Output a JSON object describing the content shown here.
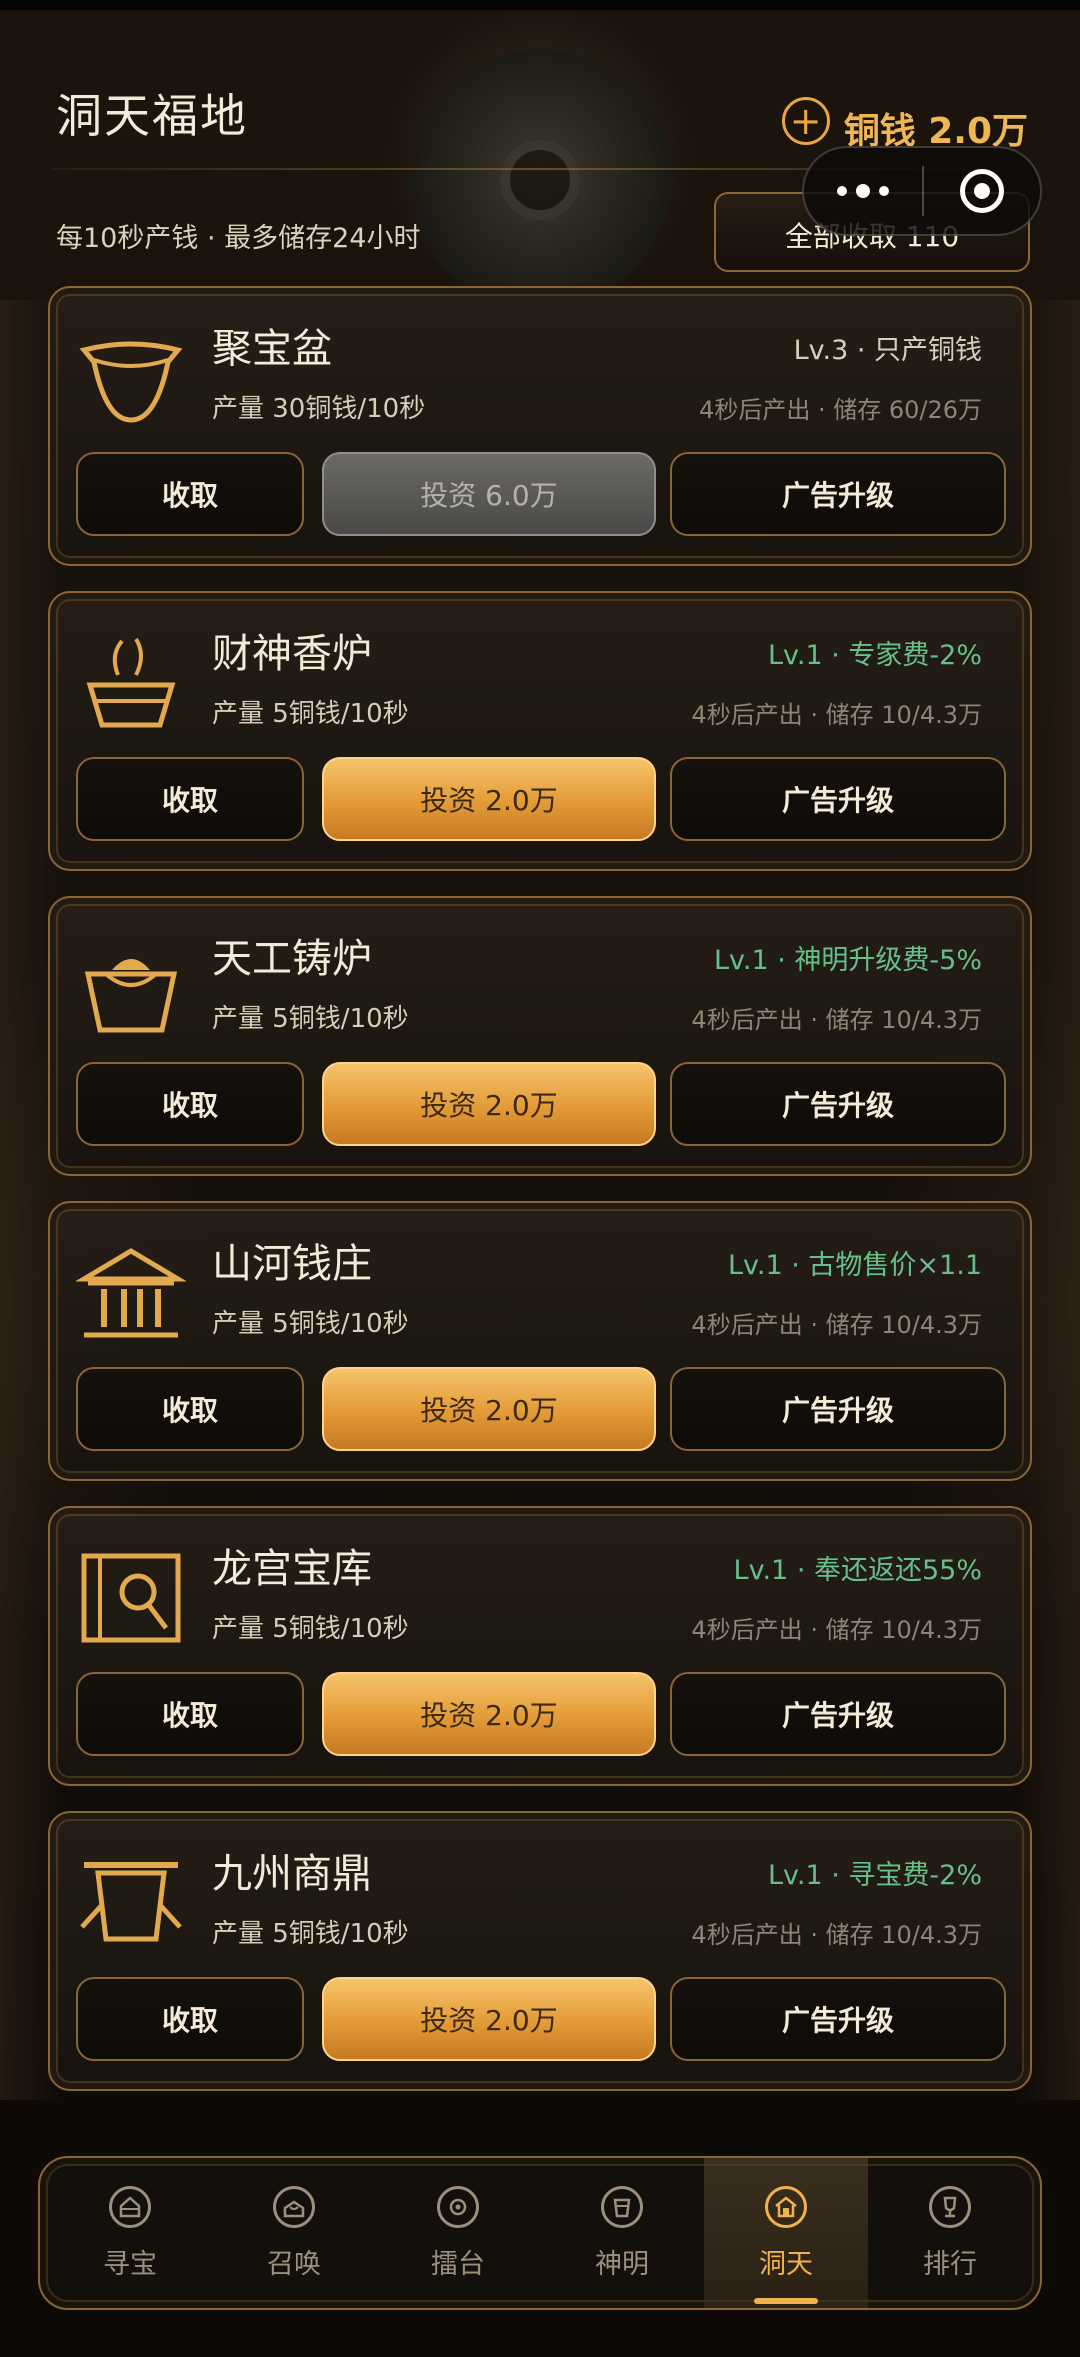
{
  "header": {
    "title": "洞天福地",
    "coins": "铜钱 2.0万",
    "subtitle": "每10秒产钱 · 最多储存24小时",
    "collect_all": "全部收取 110"
  },
  "buildings": [
    {
      "name": "聚宝盆",
      "icon": "treasure-bowl-icon",
      "rate": "产量 30铜钱/10秒",
      "level": "Lv.3 · 只产铜钱",
      "level_highlight": false,
      "timer": "4秒后产出 · 储存 60/26万",
      "collect": "收取",
      "invest": "投资 6.0万",
      "invest_disabled": true,
      "ad": "广告升级"
    },
    {
      "name": "财神香炉",
      "icon": "incense-burner-icon",
      "rate": "产量 5铜钱/10秒",
      "level": "Lv.1 · 专家费-2%",
      "level_highlight": true,
      "timer": "4秒后产出 · 储存 10/4.3万",
      "collect": "收取",
      "invest": "投资 2.0万",
      "invest_disabled": false,
      "ad": "广告升级"
    },
    {
      "name": "天工铸炉",
      "icon": "forge-icon",
      "rate": "产量 5铜钱/10秒",
      "level": "Lv.1 · 神明升级费-5%",
      "level_highlight": true,
      "timer": "4秒后产出 · 储存 10/4.3万",
      "collect": "收取",
      "invest": "投资 2.0万",
      "invest_disabled": false,
      "ad": "广告升级"
    },
    {
      "name": "山河钱庄",
      "icon": "bank-icon",
      "rate": "产量 5铜钱/10秒",
      "level": "Lv.1 · 古物售价×1.1",
      "level_highlight": true,
      "timer": "4秒后产出 · 储存 10/4.3万",
      "collect": "收取",
      "invest": "投资 2.0万",
      "invest_disabled": false,
      "ad": "广告升级"
    },
    {
      "name": "龙宫宝库",
      "icon": "vault-icon",
      "rate": "产量 5铜钱/10秒",
      "level": "Lv.1 · 奉还返还55%",
      "level_highlight": true,
      "timer": "4秒后产出 · 储存 10/4.3万",
      "collect": "收取",
      "invest": "投资 2.0万",
      "invest_disabled": false,
      "ad": "广告升级"
    },
    {
      "name": "九州商鼎",
      "icon": "cauldron-icon",
      "rate": "产量 5铜钱/10秒",
      "level": "Lv.1 · 寻宝费-2%",
      "level_highlight": true,
      "timer": "4秒后产出 · 储存 10/4.3万",
      "collect": "收取",
      "invest": "投资 2.0万",
      "invest_disabled": false,
      "ad": "广告升级"
    }
  ],
  "nav": [
    {
      "label": "寻宝",
      "icon": "treasure-hunt-icon",
      "active": false
    },
    {
      "label": "召唤",
      "icon": "summon-icon",
      "active": false
    },
    {
      "label": "擂台",
      "icon": "arena-icon",
      "active": false
    },
    {
      "label": "神明",
      "icon": "deity-icon",
      "active": false
    },
    {
      "label": "洞天",
      "icon": "home-icon",
      "active": true
    },
    {
      "label": "排行",
      "icon": "ranking-icon",
      "active": false
    }
  ],
  "colors": {
    "accent_gold": "#f0b554",
    "green_bonus": "#67c08a",
    "border": "#8a6536",
    "background": "#17110b"
  }
}
